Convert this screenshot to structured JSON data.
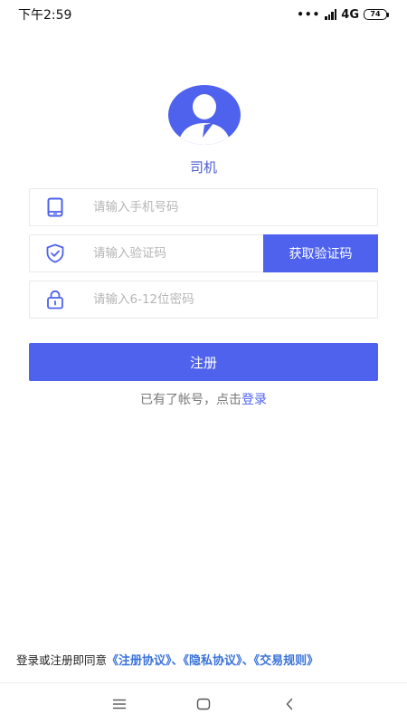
{
  "status_bar": {
    "time": "下午2:59",
    "dots": "•••",
    "network": "4G",
    "battery": "74"
  },
  "role": {
    "label": "司机",
    "avatar_color": "#4e62ee"
  },
  "form": {
    "phone_placeholder": "请输入手机号码",
    "code_placeholder": "请输入验证码",
    "code_button": "获取验证码",
    "password_placeholder": "请输入6-12位密码",
    "register_button": "注册"
  },
  "login_prompt": {
    "text": "已有了帐号，点击",
    "link": "登录"
  },
  "agreement": {
    "prefix": "登录或注册即同意",
    "register_terms": "《注册协议》",
    "sep1": "、",
    "privacy_terms": "《隐私协议》",
    "sep2": "、",
    "trade_rules": "《交易规则》"
  },
  "colors": {
    "primary": "#4e62ee",
    "link": "#3a73d9"
  },
  "icons": {
    "phone": "phone-icon",
    "shield": "shield-check-icon",
    "lock": "lock-icon",
    "nav_menu": "menu-icon",
    "nav_home": "home-icon",
    "nav_back": "back-icon"
  }
}
